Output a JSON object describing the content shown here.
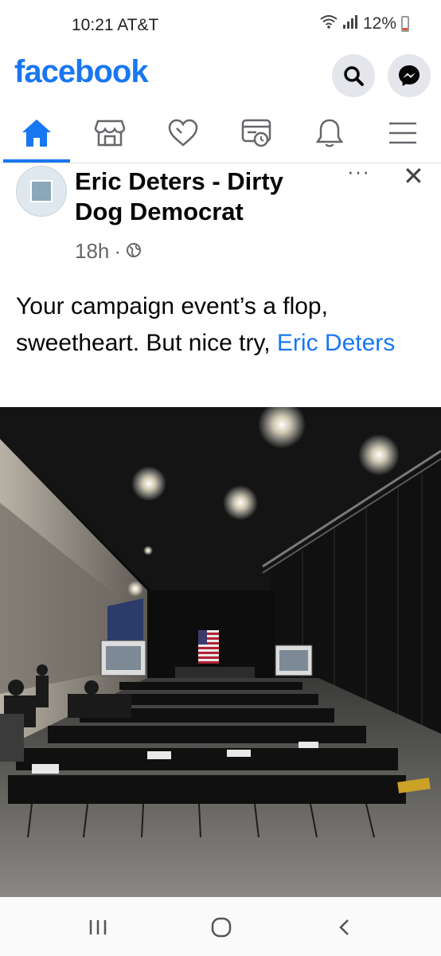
{
  "status_bar": {
    "time_carrier": "10:21 AT&T",
    "battery": "12%"
  },
  "header": {
    "logo": "facebook",
    "icons": [
      "search-icon",
      "messenger-icon"
    ],
    "brand_color": "#1877f2"
  },
  "nav_tabs": [
    {
      "icon": "home-icon",
      "active": true
    },
    {
      "icon": "marketplace-icon",
      "active": false
    },
    {
      "icon": "heart-icon",
      "active": false
    },
    {
      "icon": "watch-icon",
      "active": false
    },
    {
      "icon": "bell-icon",
      "active": false
    },
    {
      "icon": "menu-icon",
      "active": false
    }
  ],
  "post": {
    "author": "Eric Deters - Dirty Dog Democrat",
    "time": "18h",
    "separator": "·",
    "more": "···",
    "close": "✕",
    "text_before": "Your campaign event’s a flop, sweetheart. But nice try, ",
    "mention": "Eric Deters"
  },
  "system_nav": {
    "icons": [
      "recents-icon",
      "home-circle-icon",
      "back-icon"
    ]
  }
}
